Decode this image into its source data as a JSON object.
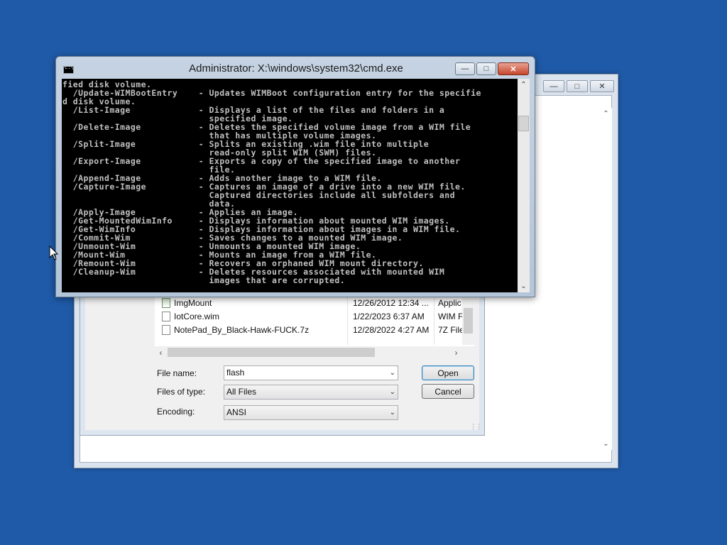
{
  "cmd_window": {
    "title": "Administrator: X:\\windows\\system32\\cmd.exe",
    "icon_label": "C:\\",
    "lines": [
      "fied disk volume.",
      "  /Update-WIMBootEntry    - Updates WIMBoot configuration entry for the specifie",
      "d disk volume.",
      "  /List-Image             - Displays a list of the files and folders in a",
      "                            specified image.",
      "  /Delete-Image           - Deletes the specified volume image from a WIM file",
      "                            that has multiple volume images.",
      "  /Split-Image            - Splits an existing .wim file into multiple",
      "                            read-only split WIM (SWM) files.",
      "  /Export-Image           - Exports a copy of the specified image to another",
      "                            file.",
      "  /Append-Image           - Adds another image to a WIM file.",
      "  /Capture-Image          - Captures an image of a drive into a new WIM file.",
      "                            Captured directories include all subfolders and",
      "                            data.",
      "  /Apply-Image            - Applies an image.",
      "  /Get-MountedWimInfo     - Displays information about mounted WIM images.",
      "  /Get-WimInfo            - Displays information about images in a WIM file.",
      "  /Commit-Wim             - Saves changes to a mounted WIM image.",
      "  /Unmount-Wim            - Unmounts a mounted WIM image.",
      "  /Mount-Wim              - Mounts an image from a WIM file.",
      "  /Remount-Wim            - Recovers an orphaned WIM mount directory.",
      "  /Cleanup-Wim            - Deletes resources associated with mounted WIM",
      "                            images that are corrupted."
    ]
  },
  "open_dialog": {
    "files": [
      {
        "name": "ImgMount",
        "date": "12/26/2012 12:34 ...",
        "type": "Applic",
        "icon": "app-icon"
      },
      {
        "name": "IotCore.wim",
        "date": "1/22/2023 6:37 AM",
        "type": "WIM F",
        "icon": "file-icon"
      },
      {
        "name": "NotePad_By_Black-Hawk-FUCK.7z",
        "date": "12/28/2022 4:27 AM",
        "type": "7Z File",
        "icon": "file-icon"
      }
    ],
    "file_name_label": "File name:",
    "file_name_value": "flash",
    "files_of_type_label": "Files of type:",
    "files_of_type_value": "All Files",
    "encoding_label": "Encoding:",
    "encoding_value": "ANSI",
    "open_label": "Open",
    "cancel_label": "Cancel"
  },
  "colors": {
    "desktop": "#1f5aa8",
    "console_bg": "#000000",
    "console_text": "#c0c0c0",
    "close_button": "#c7452d"
  }
}
